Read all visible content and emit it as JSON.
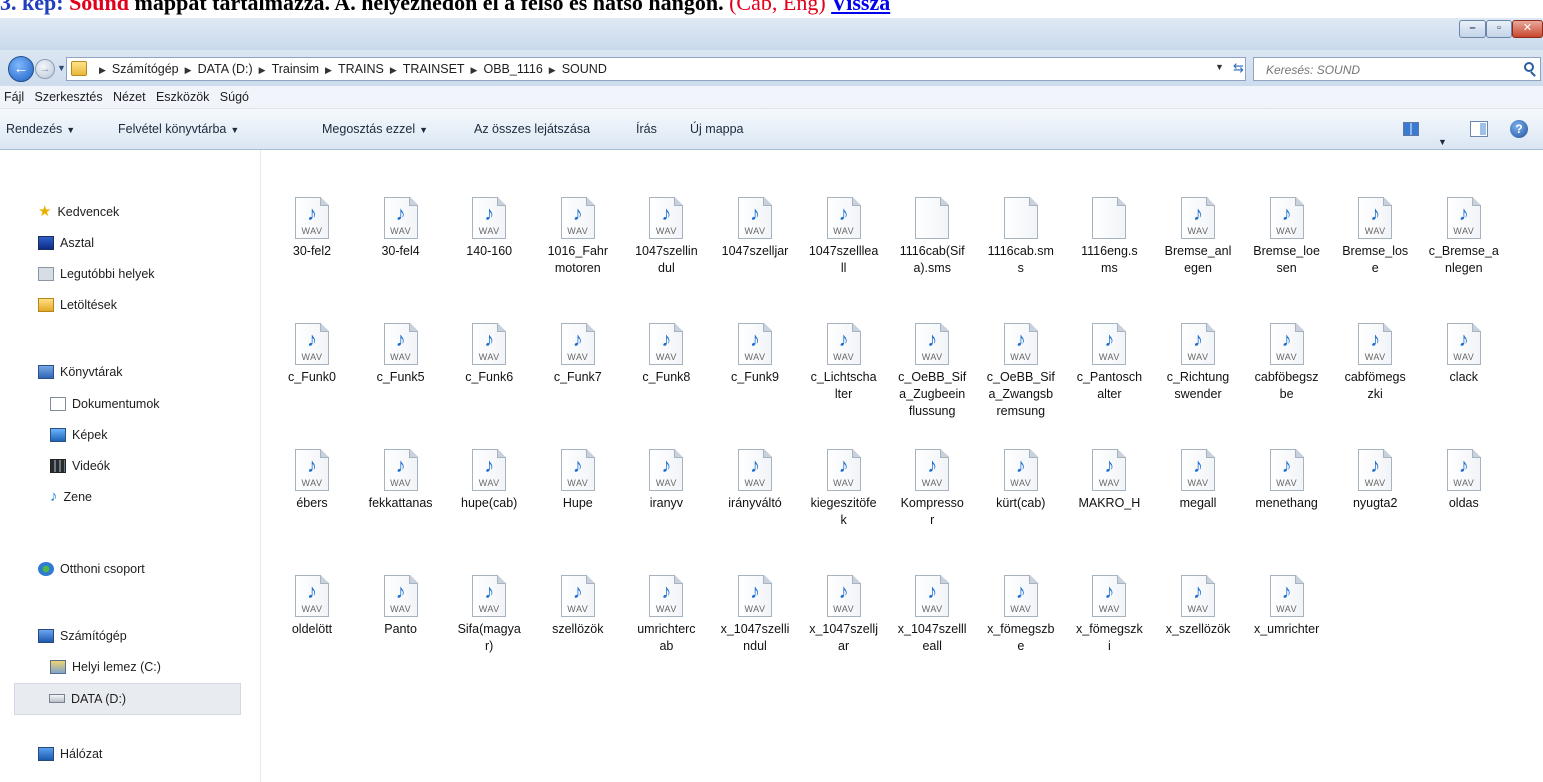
{
  "doc_strip": {
    "number": "3. kép:",
    "highlight": "Sound",
    "text": "mappát tartalmazza. A. helyezhedőn el a felső és hátsó hangon.",
    "langs": "(Cab, Eng)",
    "link": "Vissza"
  },
  "window": {
    "min_label": "–",
    "max_label": "▫",
    "close_label": "✕"
  },
  "address": {
    "crumbs": [
      "Számítógép",
      "DATA (D:)",
      "Trainsim",
      "TRAINS",
      "TRAINSET",
      "OBB_1116",
      "SOUND"
    ],
    "search_placeholder": "Keresés: SOUND"
  },
  "menu": [
    "Fájl",
    "Szerkesztés",
    "Nézet",
    "Eszközök",
    "Súgó"
  ],
  "toolbar": {
    "organize": "Rendezés",
    "include_library": "Felvétel könyvtárba",
    "share": "Megosztás ezzel",
    "play_all": "Az összes lejátszása",
    "burn": "Írás",
    "new_folder": "Új mappa"
  },
  "sidebar": {
    "favorites": "Kedvencek",
    "desktop": "Asztal",
    "recent": "Legutóbbi helyek",
    "downloads": "Letöltések",
    "libraries": "Könyvtárak",
    "documents": "Dokumentumok",
    "pictures": "Képek",
    "videos": "Videók",
    "music": "Zene",
    "homegroup": "Otthoni csoport",
    "computer": "Számítógép",
    "c_drive": "Helyi lemez (C:)",
    "d_drive": "DATA (D:)",
    "network": "Hálózat"
  },
  "files": [
    {
      "name": "30-fel2",
      "type": "wav"
    },
    {
      "name": "30-fel4",
      "type": "wav"
    },
    {
      "name": "140-160",
      "type": "wav"
    },
    {
      "name": "1016_Fahrmotoren",
      "type": "wav"
    },
    {
      "name": "1047szellindul",
      "type": "wav"
    },
    {
      "name": "1047szelljar",
      "type": "wav"
    },
    {
      "name": "1047szellleall",
      "type": "wav"
    },
    {
      "name": "1116cab(Sifa).sms",
      "type": "blank"
    },
    {
      "name": "1116cab.sms",
      "type": "blank"
    },
    {
      "name": "1116eng.sms",
      "type": "blank"
    },
    {
      "name": "Bremse_anlegen",
      "type": "wav"
    },
    {
      "name": "Bremse_loesen",
      "type": "wav"
    },
    {
      "name": "Bremse_lose",
      "type": "wav"
    },
    {
      "name": "c_Bremse_anlegen",
      "type": "wav"
    },
    {
      "name": "c_Funk0",
      "type": "wav"
    },
    {
      "name": "c_Funk5",
      "type": "wav"
    },
    {
      "name": "c_Funk6",
      "type": "wav"
    },
    {
      "name": "c_Funk7",
      "type": "wav"
    },
    {
      "name": "c_Funk8",
      "type": "wav"
    },
    {
      "name": "c_Funk9",
      "type": "wav"
    },
    {
      "name": "c_Lichtschalter",
      "type": "wav"
    },
    {
      "name": "c_OeBB_Sifa_Zugbeeinflussung",
      "type": "wav"
    },
    {
      "name": "c_OeBB_Sifa_Zwangsbremsung",
      "type": "wav"
    },
    {
      "name": "c_Pantoschalter",
      "type": "wav"
    },
    {
      "name": "c_Richtungswender",
      "type": "wav"
    },
    {
      "name": "cabföbegszbe",
      "type": "wav"
    },
    {
      "name": "cabfömegszki",
      "type": "wav"
    },
    {
      "name": "clack",
      "type": "wav"
    },
    {
      "name": "ébers",
      "type": "wav"
    },
    {
      "name": "fekkattanas",
      "type": "wav"
    },
    {
      "name": "hupe(cab)",
      "type": "wav"
    },
    {
      "name": "Hupe",
      "type": "wav"
    },
    {
      "name": "iranyv",
      "type": "wav"
    },
    {
      "name": "irányváltó",
      "type": "wav"
    },
    {
      "name": "kiegeszitöfek",
      "type": "wav"
    },
    {
      "name": "Kompressor",
      "type": "wav"
    },
    {
      "name": "kürt(cab)",
      "type": "wav"
    },
    {
      "name": "MAKRO_H",
      "type": "wav"
    },
    {
      "name": "megall",
      "type": "wav"
    },
    {
      "name": "menethang",
      "type": "wav"
    },
    {
      "name": "nyugta2",
      "type": "wav"
    },
    {
      "name": "oldas",
      "type": "wav"
    },
    {
      "name": "oldelött",
      "type": "wav"
    },
    {
      "name": "Panto",
      "type": "wav"
    },
    {
      "name": "Sifa(magyar)",
      "type": "wav"
    },
    {
      "name": "szellözök",
      "type": "wav"
    },
    {
      "name": "umrichtercab",
      "type": "wav"
    },
    {
      "name": "x_1047szellindul",
      "type": "wav"
    },
    {
      "name": "x_1047szelljar",
      "type": "wav"
    },
    {
      "name": "x_1047szellleall",
      "type": "wav"
    },
    {
      "name": "x_fömegszbe",
      "type": "wav"
    },
    {
      "name": "x_fömegszki",
      "type": "wav"
    },
    {
      "name": "x_szellözök",
      "type": "wav"
    },
    {
      "name": "x_umrichter",
      "type": "wav"
    }
  ],
  "wav_tag": "WAV"
}
